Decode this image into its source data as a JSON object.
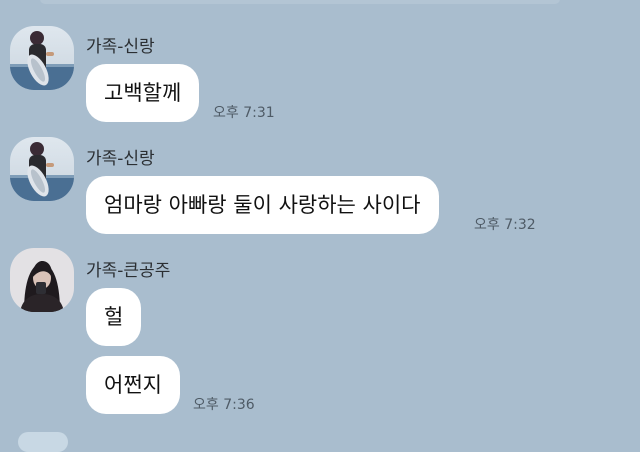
{
  "messages": [
    {
      "sender": "가족-신랑",
      "avatar": "fisherman-photo-avatar",
      "text": "고백할께",
      "time": "오후 7:31"
    },
    {
      "sender": "가족-신랑",
      "avatar": "fisherman-photo-avatar",
      "text": "엄마랑 아빠랑 둘이 사랑하는 사이다",
      "time": "오후 7:32"
    },
    {
      "sender": "가족-큰공주",
      "avatar": "woman-photo-avatar",
      "texts": [
        "헐",
        "어쩐지"
      ],
      "time": "오후 7:36"
    }
  ],
  "colors": {
    "background": "#a9bdce",
    "bubble": "#ffffff",
    "time_text": "#4f5b66"
  }
}
